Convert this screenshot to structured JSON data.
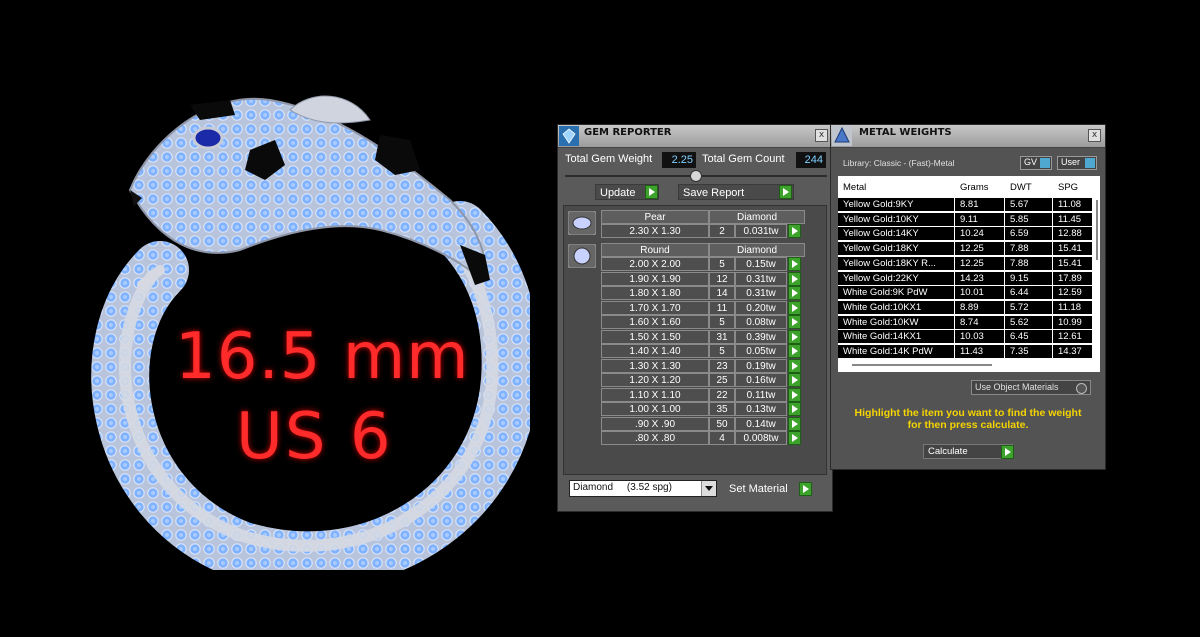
{
  "ring_label": {
    "line1": "16.5 mm",
    "line2": "US 6"
  },
  "gem_reporter": {
    "title": "GEM REPORTER",
    "close": "x",
    "total_weight_label": "Total Gem Weight",
    "total_weight_value": "2.25",
    "total_count_label": "Total Gem Count",
    "total_count_value": "244",
    "update_label": "Update",
    "save_report_label": "Save Report",
    "pear": {
      "shape": "Pear",
      "material": "Diamond",
      "size": "2.30 X 1.30",
      "count": "2",
      "weight": "0.031tw"
    },
    "round": {
      "shape": "Round",
      "material": "Diamond",
      "rows": [
        {
          "size": "2.00 X 2.00",
          "count": "5",
          "weight": "0.15tw"
        },
        {
          "size": "1.90 X 1.90",
          "count": "12",
          "weight": "0.31tw"
        },
        {
          "size": "1.80 X 1.80",
          "count": "14",
          "weight": "0.31tw"
        },
        {
          "size": "1.70 X 1.70",
          "count": "11",
          "weight": "0.20tw"
        },
        {
          "size": "1.60 X 1.60",
          "count": "5",
          "weight": "0.08tw"
        },
        {
          "size": "1.50 X 1.50",
          "count": "31",
          "weight": "0.39tw"
        },
        {
          "size": "1.40 X 1.40",
          "count": "5",
          "weight": "0.05tw"
        },
        {
          "size": "1.30 X 1.30",
          "count": "23",
          "weight": "0.19tw"
        },
        {
          "size": "1.20 X 1.20",
          "count": "25",
          "weight": "0.16tw"
        },
        {
          "size": "1.10 X 1.10",
          "count": "22",
          "weight": "0.11tw"
        },
        {
          "size": "1.00 X 1.00",
          "count": "35",
          "weight": "0.13tw"
        },
        {
          "size": ".90 X .90",
          "count": "50",
          "weight": "0.14tw"
        },
        {
          "size": ".80 X .80",
          "count": "4",
          "weight": "0.008tw"
        }
      ]
    },
    "material_select": "Diamond     (3.52 spg)",
    "set_material_label": "Set Material"
  },
  "metal_weights": {
    "title": "METAL WEIGHTS",
    "close": "x",
    "library": "Library: Classic - (Fast)-Metal",
    "gv_label": "GV",
    "user_label": "User",
    "columns": [
      "Metal",
      "Grams",
      "DWT",
      "SPG"
    ],
    "rows": [
      [
        "Yellow Gold:9KY",
        "8.81",
        "5.67",
        "11.08"
      ],
      [
        "Yellow Gold:10KY",
        "9.11",
        "5.85",
        "11.45"
      ],
      [
        "Yellow Gold:14KY",
        "10.24",
        "6.59",
        "12.88"
      ],
      [
        "Yellow Gold:18KY",
        "12.25",
        "7.88",
        "15.41"
      ],
      [
        "Yellow Gold:18KY R...",
        "12.25",
        "7.88",
        "15.41"
      ],
      [
        "Yellow Gold:22KY",
        "14.23",
        "9.15",
        "17.89"
      ],
      [
        "White Gold:9K PdW",
        "10.01",
        "6.44",
        "12.59"
      ],
      [
        "White Gold:10KX1",
        "8.89",
        "5.72",
        "11.18"
      ],
      [
        "White Gold:10KW",
        "8.74",
        "5.62",
        "10.99"
      ],
      [
        "White Gold:14KX1",
        "10.03",
        "6.45",
        "12.61"
      ],
      [
        "White Gold:14K PdW",
        "11.43",
        "7.35",
        "14.37"
      ]
    ],
    "use_object_materials": "Use Object Materials",
    "hint_line1": "Highlight the item you want to find the weight",
    "hint_line2": "for then press calculate.",
    "calculate_label": "Calculate"
  }
}
